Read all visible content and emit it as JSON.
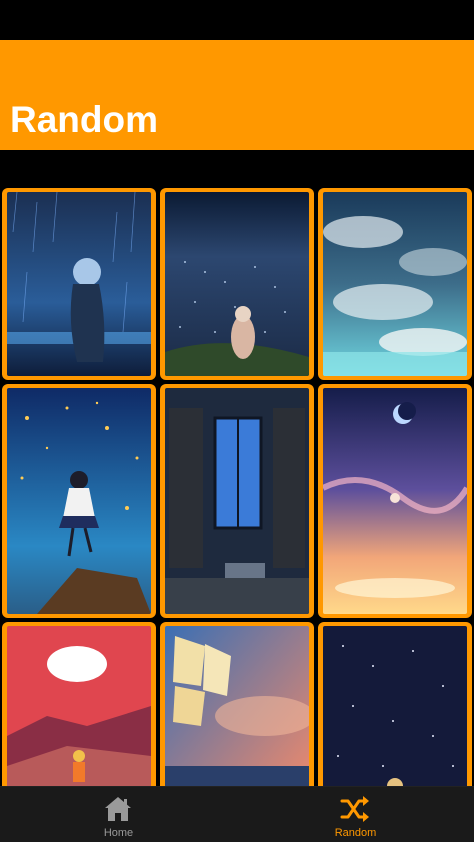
{
  "app": {
    "title": "Random",
    "accent_color": "#FF9800"
  },
  "gallery": {
    "items": [
      {
        "name": "wallpaper-rain-girl"
      },
      {
        "name": "wallpaper-city-night-view"
      },
      {
        "name": "wallpaper-sky-clouds"
      },
      {
        "name": "wallpaper-firefly-girl"
      },
      {
        "name": "wallpaper-room-window"
      },
      {
        "name": "wallpaper-moon-sunset"
      },
      {
        "name": "wallpaper-red-desert"
      },
      {
        "name": "wallpaper-sail-ship"
      },
      {
        "name": "wallpaper-starry-night"
      }
    ]
  },
  "tabs": {
    "home": {
      "label": "Home",
      "icon": "home-icon",
      "color": "#9a9a9a"
    },
    "random": {
      "label": "Random",
      "icon": "shuffle-icon",
      "color": "#FF9800",
      "active": true
    }
  }
}
